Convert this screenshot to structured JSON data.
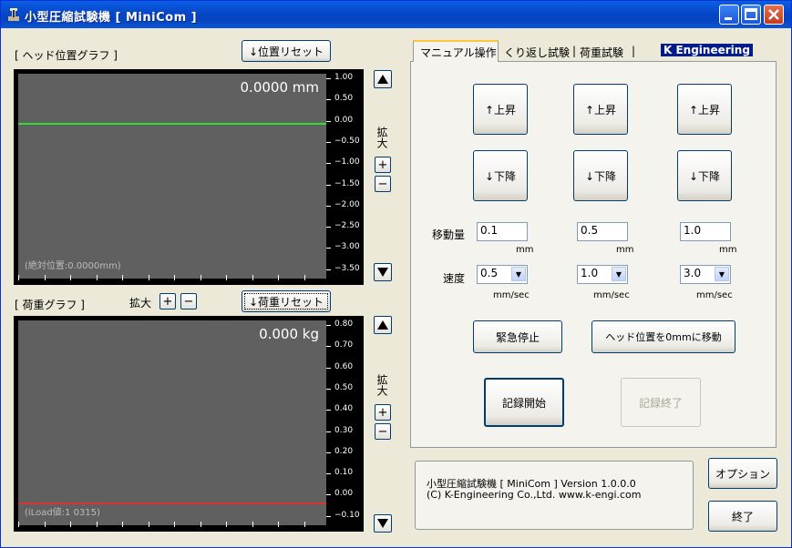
{
  "window": {
    "title": "小型圧縮試験機 [ MiniCom ]"
  },
  "head_graph": {
    "label": "[ ヘッド位置グラフ ]",
    "reset_label": "↓位置リセット",
    "readout": "0.0000 mm",
    "footer": "(絶対位置:0.0000mm)",
    "y_ticks": [
      "1.00",
      "0.50",
      "0.00",
      "−0.50",
      "−1.00",
      "−1.50",
      "−2.00",
      "−2.50",
      "−3.00",
      "−3.50"
    ],
    "line_color": "#33dd33",
    "zoom_label": "拡大"
  },
  "load_graph": {
    "label": "[ 荷重グラフ ]",
    "zoom_label": "拡大",
    "reset_label": "↓荷重リセット",
    "readout": "0.000 kg",
    "footer": "(iLoad値:1 0315)",
    "y_ticks": [
      "0.80",
      "0.70",
      "0.60",
      "0.50",
      "0.40",
      "0.30",
      "0.20",
      "0.10",
      "0.00",
      "−0.10"
    ],
    "line_color": "#dd3333"
  },
  "tabs": [
    "マニュアル操作",
    "くり返し試験",
    "荷重試験"
  ],
  "logo": "K Engineering",
  "manual": {
    "up_label": "↑上昇",
    "down_label": "↓下降",
    "move_label": "移動量",
    "speed_label": "速度",
    "columns": [
      {
        "amount": "0.1",
        "unit": "mm",
        "speed": "0.5",
        "speed_unit": "mm/sec"
      },
      {
        "amount": "0.5",
        "unit": "mm",
        "speed": "1.0",
        "speed_unit": "mm/sec"
      },
      {
        "amount": "1.0",
        "unit": "mm",
        "speed": "3.0",
        "speed_unit": "mm/sec"
      }
    ],
    "emergency_stop": "緊急停止",
    "move_to_zero": "ヘッド位置を0mmに移動",
    "record_start": "記録開始",
    "record_end": "記録終了"
  },
  "info": {
    "line1": "小型圧縮試験機 [ MiniCom ] Version 1.0.0.0",
    "line2": "(C) K-Engineering Co.,Ltd.   www.k-engi.com"
  },
  "options_label": "オプション",
  "exit_label": "終了",
  "zoom_plus": "+",
  "zoom_minus": "−"
}
